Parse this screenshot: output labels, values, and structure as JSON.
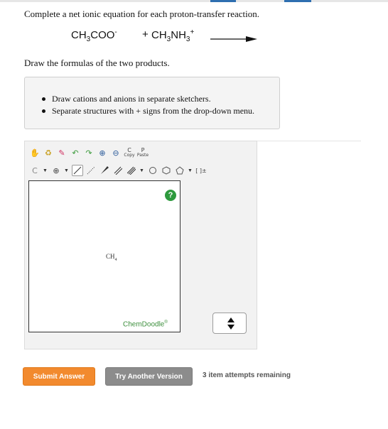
{
  "question": "Complete a net ionic equation for each proton-transfer reaction.",
  "equation": {
    "reactant1": {
      "main": "CH",
      "sub1": "3",
      "mid": "COO",
      "sup": "-"
    },
    "plus": "+",
    "reactant2": {
      "main": "CH",
      "sub1": "3",
      "mid": "NH",
      "sub2": "3",
      "sup": "+"
    }
  },
  "instruction": "Draw the formulas of the two products.",
  "notes": [
    "Draw cations and anions in separate sketchers.",
    "Separate structures with + signs from the drop-down menu."
  ],
  "sketcher": {
    "toolbar_row1": [
      {
        "name": "hand-icon",
        "glyph": "✋"
      },
      {
        "name": "recycle-icon",
        "glyph": "♻"
      },
      {
        "name": "eraser-icon",
        "glyph": "✎"
      },
      {
        "name": "undo-icon",
        "glyph": "↶"
      },
      {
        "name": "redo-icon",
        "glyph": "↷"
      },
      {
        "name": "zoom-in-icon",
        "glyph": "⊕"
      },
      {
        "name": "zoom-out-icon",
        "glyph": "⊖"
      }
    ],
    "copy_label": "Copy",
    "paste_label": "Paste",
    "copy_letter": "C",
    "paste_letter": "P",
    "atom_label": "C",
    "charge_label": "⊕",
    "bracket_label": "[ ]±",
    "molecule": {
      "main": "CH",
      "sub": "4"
    },
    "help": "?",
    "brand": "ChemDoodle",
    "brand_mark": "®"
  },
  "buttons": {
    "submit": "Submit Answer",
    "try_another": "Try Another Version"
  },
  "attempts": "3 item attempts remaining",
  "colors": {
    "accent": "#f28a2e",
    "secondary": "#8c8c8c",
    "brand_green": "#3c8f3c"
  }
}
